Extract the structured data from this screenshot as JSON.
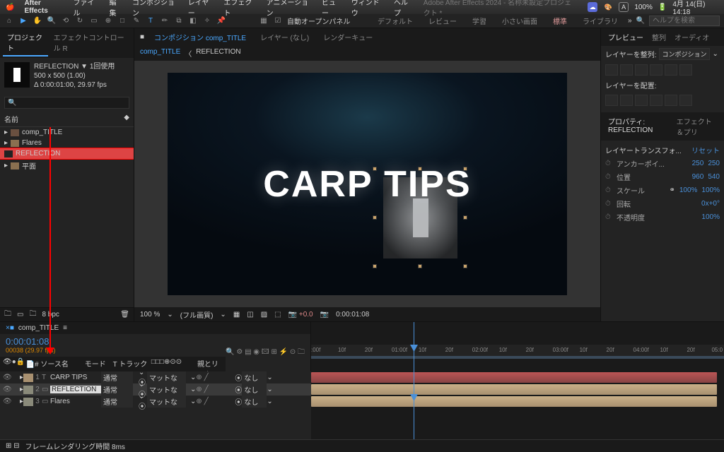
{
  "menubar": {
    "app": "After Effects",
    "items": [
      "ファイル",
      "編集",
      "コンポジション",
      "レイヤー",
      "エフェクト",
      "アニメーション",
      "ビュー",
      "ウィンドウ",
      "ヘルプ"
    ],
    "title": "Adobe After Effects 2024 - 名称未設定プロジェクト *",
    "battery": "100%",
    "clock": "4月 14(日) 14:18"
  },
  "toolbar": {
    "autopanel": "自動オープンパネル",
    "modes": [
      "デフォルト",
      "レビュー",
      "学習",
      "小さい画面",
      "標準",
      "ライブラリ"
    ],
    "help_ph": "ヘルプを検索"
  },
  "left": {
    "tabs": [
      "プロジェクト",
      "エフェクトコントロール R"
    ],
    "item_name": "REFLECTION",
    "item_use": "1回使用",
    "item_dim": "500 x 500 (1.00)",
    "item_dur": "Δ 0:00:01:00, 29.97 fps",
    "col": "名前",
    "items": [
      "comp_TITLE",
      "Flares",
      "REFLECTION",
      "平面"
    ],
    "bpc": "8 bpc"
  },
  "center": {
    "tabs": [
      "コンポジション comp_TITLE",
      "レイヤー (なし)",
      "レンダーキュー"
    ],
    "crumb": [
      "comp_TITLE",
      "REFLECTION"
    ],
    "text": "CARP TIPS",
    "zoom": "100 %",
    "quality": "(フル画質)",
    "time": "0:00:01:08"
  },
  "right": {
    "tabs": [
      "プレビュー",
      "整列",
      "オーディオ"
    ],
    "align_lbl": "レイヤーを整列:",
    "align_to": "コンポジション",
    "dist_lbl": "レイヤーを配置:",
    "props_lbl": "プロパティ: REFLECTION",
    "fx_lbl": "エフェクト＆プリ",
    "transform": "レイヤートランスフォ...",
    "reset": "リセット",
    "p": [
      {
        "n": "アンカーポイ...",
        "v1": "250",
        "v2": "250"
      },
      {
        "n": "位置",
        "v1": "960",
        "v2": "540"
      },
      {
        "n": "スケール",
        "v1": "100%",
        "v2": "100%",
        "link": "⚭"
      },
      {
        "n": "回転",
        "v1": "0x+0°"
      },
      {
        "n": "不透明度",
        "v1": "100%"
      }
    ]
  },
  "timeline": {
    "comp": "comp_TITLE",
    "tc": "0:00:01:08",
    "frames": "00038 (29.97 fps)",
    "cols": [
      "ソース名",
      "モード",
      "T トラックマ...",
      "親とリンク"
    ],
    "layers": [
      {
        "num": "1",
        "name": "CARP TIPS",
        "mode": "通常",
        "trk": "マットな",
        "par": "なし",
        "type": "T"
      },
      {
        "num": "2",
        "name": "REFLECTION",
        "mode": "通常",
        "trk": "マットな",
        "par": "なし",
        "type": "C",
        "sel": true
      },
      {
        "num": "3",
        "name": "Flares",
        "mode": "通常",
        "trk": "マットな",
        "par": "なし",
        "type": "C"
      }
    ],
    "ticks": [
      ":00f",
      "10f",
      "20f",
      "01:00f",
      "10f",
      "20f",
      "02:00f",
      "10f",
      "20f",
      "03:00f",
      "10f",
      "20f",
      "04:00f",
      "10f",
      "20f",
      "05:0"
    ],
    "render": "フレームレンダリング時間 8ms"
  }
}
